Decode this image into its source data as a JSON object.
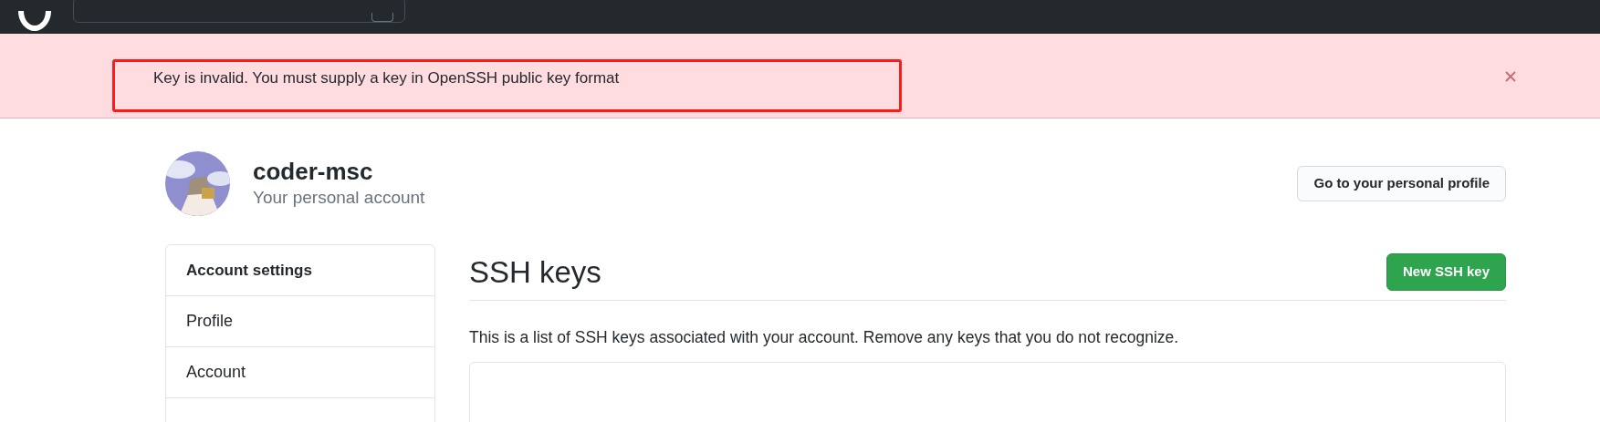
{
  "flash": {
    "message": "Key is invalid. You must supply a key in OpenSSH public key format"
  },
  "profile": {
    "name": "coder-msc",
    "subtitle": "Your personal account",
    "button": "Go to your personal profile"
  },
  "sidebar": {
    "title": "Account settings",
    "items": [
      {
        "label": "Profile",
        "selected": false
      },
      {
        "label": "Account",
        "selected": false
      }
    ]
  },
  "main": {
    "title": "SSH keys",
    "new_button": "New SSH key",
    "description": "This is a list of SSH keys associated with your account. Remove any keys that you do not recognize."
  }
}
